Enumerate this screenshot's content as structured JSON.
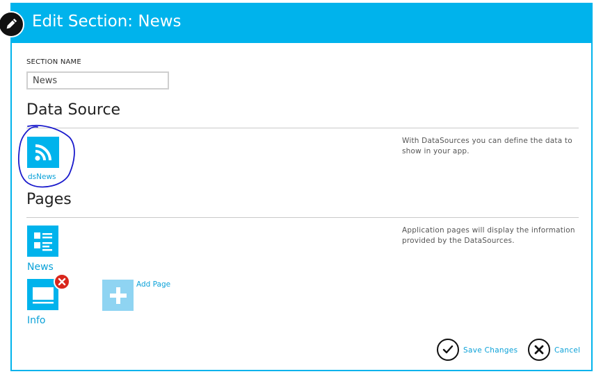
{
  "dialog": {
    "title": "Edit Section: News"
  },
  "section_name": {
    "label": "SECTION NAME",
    "value": "News"
  },
  "data_source": {
    "heading": "Data Source",
    "help": "With DataSources you can define the data to show in your app.",
    "items": [
      {
        "label": "dsNews",
        "icon": "rss-icon"
      }
    ]
  },
  "pages": {
    "heading": "Pages",
    "help": "Application pages will display the information provided by the DataSources.",
    "items": [
      {
        "label": "News",
        "icon": "list-page-icon"
      },
      {
        "label": "Info",
        "icon": "detail-page-icon"
      }
    ],
    "add_label": "Add Page"
  },
  "actions": {
    "save_label": "Save Changes",
    "cancel_label": "Cancel"
  },
  "colors": {
    "accent": "#00b3ec",
    "link": "#0aa1d8",
    "delete": "#d9261c",
    "annotation": "#1a1acc"
  }
}
